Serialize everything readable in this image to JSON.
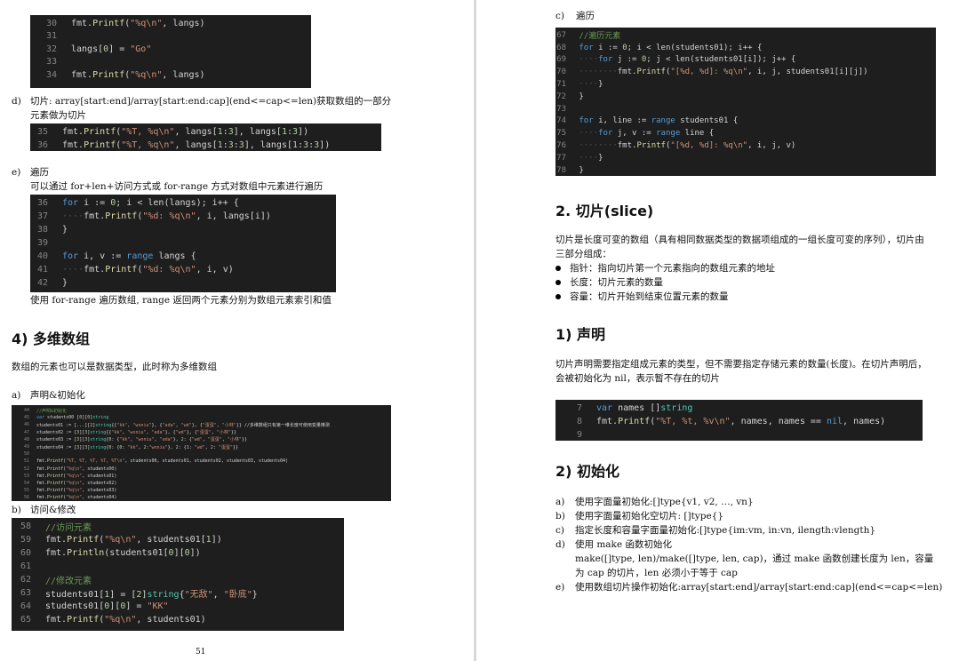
{
  "left": {
    "code1": [
      {
        "n": "30",
        "t": "fmt.Printf(\"%q\\n\", langs)"
      },
      {
        "n": "31",
        "t": ""
      },
      {
        "n": "32",
        "t": "langs[0] = \"Go\""
      },
      {
        "n": "33",
        "t": ""
      },
      {
        "n": "34",
        "t": "fmt.Printf(\"%q\\n\", langs)"
      }
    ],
    "d_label": "d)",
    "d_text1": "切片: array[start:end]/array[start:end:cap](end<=cap<=len)获取数组的一部分",
    "d_text2": "元素做为切片",
    "code2": [
      {
        "n": "35",
        "t": "fmt.Printf(\"%T, %q\\n\", langs[1:3], langs[1:3])"
      },
      {
        "n": "36",
        "t": "fmt.Printf(\"%T, %q\\n\", langs[1:3:3], langs[1:3:3])"
      }
    ],
    "e_label": "e)",
    "e_title": "遍历",
    "e_text": "可以通过 for+len+访问方式或 for-range 方式对数组中元素进行遍历",
    "code3": [
      {
        "n": "36",
        "t": "for i := 0; i < len(langs); i++ {"
      },
      {
        "n": "37",
        "t": "    fmt.Printf(\"%d: %q\\n\", i, langs[i])"
      },
      {
        "n": "38",
        "t": "}"
      },
      {
        "n": "39",
        "t": ""
      },
      {
        "n": "40",
        "t": "for i, v := range langs {"
      },
      {
        "n": "41",
        "t": "    fmt.Printf(\"%d: %q\\n\", i, v)"
      },
      {
        "n": "42",
        "t": "}"
      }
    ],
    "range_note": "使用 for-range 遍历数组, range 返回两个元素分别为数组元素索引和值",
    "heading4": "4) 多维数组",
    "multi_intro": "数组的元素也可以是数据类型，此时称为多维数组",
    "a_label": "a)",
    "a_title": "声明&初始化",
    "code4": [
      {
        "n": "44",
        "t": "//声明&初始化"
      },
      {
        "n": "45",
        "t": "var students00 [0][0]string"
      },
      {
        "n": "46",
        "t": "students01 := [...][2]string{{\"kk\", \"woniu\"}, {\"ada\", \"wd\"}, {\"蛋蛋\", \"小林\"}} //多维数组只有第一维长度可使用变量推测"
      },
      {
        "n": "47",
        "t": "students02 := [3][3]string{{\"kk\", \"woniu\", \"ada\"}, {\"wd\"}, {\"蛋蛋\", \"小林\"}}"
      },
      {
        "n": "48",
        "t": "students03 := [3][3]string{0: {\"kk\", \"woniu\", \"ada\"}, 2: {\"wd\", \"蛋蛋\", \"小林\"}}"
      },
      {
        "n": "49",
        "t": "students04 := [3][3]string{0: {0: \"kk\", 2:\"woniu\"}, 2: {1: \"wd\", 2: \"蛋蛋\"}}"
      },
      {
        "n": "50",
        "t": ""
      },
      {
        "n": "51",
        "t": "fmt.Printf(\"%T, %T, %T, %T, %T\\n\", students00, students01, students02, students03, students04)"
      },
      {
        "n": "52",
        "t": "fmt.Printf(\"%q\\n\", students00)"
      },
      {
        "n": "53",
        "t": "fmt.Printf(\"%q\\n\", students01)"
      },
      {
        "n": "54",
        "t": "fmt.Printf(\"%q\\n\", students02)"
      },
      {
        "n": "55",
        "t": "fmt.Printf(\"%q\\n\", students03)"
      },
      {
        "n": "56",
        "t": "fmt.Printf(\"%q\\n\", students04)"
      }
    ],
    "b_label": "b)",
    "b_title": "访问&修改",
    "code5": [
      {
        "n": "58",
        "t": "//访问元素"
      },
      {
        "n": "59",
        "t": "fmt.Printf(\"%q\\n\", students01[1])"
      },
      {
        "n": "60",
        "t": "fmt.Println(students01[0][0])"
      },
      {
        "n": "61",
        "t": ""
      },
      {
        "n": "62",
        "t": "//修改元素"
      },
      {
        "n": "63",
        "t": "students01[1] = [2]string{\"无敌\", \"卧底\"}"
      },
      {
        "n": "64",
        "t": "students01[0][0] = \"KK\""
      },
      {
        "n": "65",
        "t": "fmt.Printf(\"%q\\n\", students01)"
      }
    ],
    "page_number": "51"
  },
  "right": {
    "c_label": "c)",
    "c_title": "遍历",
    "code6": [
      {
        "n": "67",
        "t": "//遍历元素"
      },
      {
        "n": "68",
        "t": "for i := 0; i < len(students01); i++ {"
      },
      {
        "n": "69",
        "t": "    for j := 0; j < len(students01[i]); j++ {"
      },
      {
        "n": "70",
        "t": "        fmt.Printf(\"[%d, %d]: %q\\n\", i, j, students01[i][j])"
      },
      {
        "n": "71",
        "t": "    }"
      },
      {
        "n": "72",
        "t": "}"
      },
      {
        "n": "73",
        "t": ""
      },
      {
        "n": "74",
        "t": "for i, line := range students01 {"
      },
      {
        "n": "75",
        "t": "    for j, v := range line {"
      },
      {
        "n": "76",
        "t": "        fmt.Printf(\"[%d, %d]: %q\\n\", i, j, v)"
      },
      {
        "n": "77",
        "t": "    }"
      },
      {
        "n": "78",
        "t": "}"
      }
    ],
    "heading_slice": "2. 切片(slice)",
    "slice_intro1": "切片是长度可变的数组（具有相同数据类型的数据项组成的一组长度可变的序列），切片由",
    "slice_intro2": "三部分组成：",
    "bullets": [
      "指针：指向切片第一个元素指向的数组元素的地址",
      "长度：切片元素的数量",
      "容量：切片开始到结束位置元素的数量"
    ],
    "heading_decl": "1) 声明",
    "decl1": "切片声明需要指定组成元素的类型，但不需要指定存储元素的数量(长度)。在切片声明后，",
    "decl2": "会被初始化为 nil，表示暂不存在的切片",
    "code7": [
      {
        "n": "7",
        "t": "var names []string"
      },
      {
        "n": "8",
        "t": "fmt.Printf(\"%T, %t, %v\\n\", names, names == nil, names)"
      },
      {
        "n": "9",
        "t": ""
      }
    ],
    "heading_init": "2) 初始化",
    "init_items": [
      {
        "label": "a)",
        "text": "使用字面量初始化:[]type{v1, v2, …, vn}"
      },
      {
        "label": "b)",
        "text": "使用字面量初始化空切片: []type{}"
      },
      {
        "label": "c)",
        "text": "指定长度和容量字面量初始化:[]type{im:vm, in:vn, ilength:vlength}"
      },
      {
        "label": "d)",
        "text": "使用 make 函数初始化"
      },
      {
        "label": "",
        "text": "make([]type, len)/make([]type, len, cap)，通过 make 函数创建长度为 len，容量"
      },
      {
        "label": "",
        "text": "为 cap 的切片，len 必须小于等于 cap"
      },
      {
        "label": "e)",
        "text": "使用数组切片操作初始化:array[start:end]/array[start:end:cap](end<=cap<=len)"
      }
    ]
  }
}
